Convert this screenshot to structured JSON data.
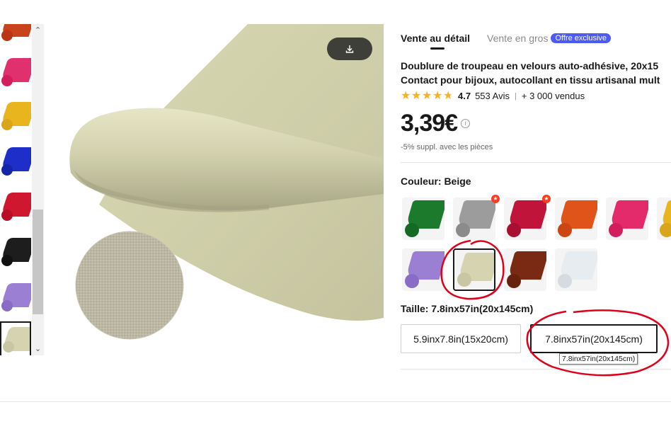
{
  "thumbnails": [
    {
      "name": "orange",
      "roll": "#c9431d",
      "dot": "#b83614"
    },
    {
      "name": "rose",
      "roll": "#e0306e",
      "dot": "#d41d5d"
    },
    {
      "name": "yellow",
      "roll": "#e8b51e",
      "dot": "#d9a51a"
    },
    {
      "name": "blue",
      "roll": "#1d2fc8",
      "dot": "#1625a8"
    },
    {
      "name": "red",
      "roll": "#cf1730",
      "dot": "#b80f26"
    },
    {
      "name": "black",
      "roll": "#1d1d1d",
      "dot": "#111111"
    },
    {
      "name": "lavender",
      "roll": "#9a7fd3",
      "dot": "#8a6cc6"
    },
    {
      "name": "beige",
      "roll": "#d6d3b0",
      "dot": "#c9c6a4"
    }
  ],
  "tabs": {
    "retail": "Vente au détail",
    "wholesale": "Vente en gros",
    "exclusive_badge": "Offre exclusive"
  },
  "product": {
    "title_line1": "Doublure de troupeau en velours auto-adhésive, 20x15",
    "title_line2": "Contact pour bijoux, autocollant en tissu artisanal mult",
    "rating": "4.7",
    "reviews": "553 Avis",
    "separator": "|",
    "sold": "+ 3 000 vendus",
    "stars": 4.7,
    "price": "3,39€",
    "discount_note": "-5% suppl. avec les pièces"
  },
  "color": {
    "label": "Couleur: Beige",
    "swatches": [
      {
        "name": "green",
        "roll": "#1c7a2c",
        "dot": "#156a23",
        "hot": false
      },
      {
        "name": "grey",
        "roll": "#9c9c9c",
        "dot": "#8b8b8b",
        "hot": true
      },
      {
        "name": "crimson",
        "roll": "#c0143a",
        "dot": "#a80f31",
        "hot": true
      },
      {
        "name": "orange",
        "roll": "#e0541a",
        "dot": "#cc4512",
        "hot": false
      },
      {
        "name": "pink",
        "roll": "#e32b6c",
        "dot": "#d41d5d",
        "hot": false
      },
      {
        "name": "yellow",
        "roll": "#e8b51e",
        "dot": "#d9a51a",
        "hot": false
      },
      {
        "name": "lavender",
        "roll": "#9a7fd3",
        "dot": "#8a6cc6",
        "hot": false
      },
      {
        "name": "beige",
        "roll": "#d6d3b0",
        "dot": "#c9c6a4",
        "hot": false,
        "selected": true
      },
      {
        "name": "brown",
        "roll": "#7a2a12",
        "dot": "#68210c",
        "hot": false
      },
      {
        "name": "white",
        "roll": "#e6ecf0",
        "dot": "#d5dbe0",
        "hot": false
      }
    ]
  },
  "size": {
    "label": "Taille: 7.8inx57in(20x145cm)",
    "options": [
      "5.9inx7.8in(15x20cm)",
      "7.8inx57in(20x145cm)"
    ],
    "tooltip": "7.8inx57in(20x145cm)"
  },
  "colors": {
    "accent": "#4d5bf4",
    "star": "#fbb11b",
    "annotation": "#e0001a"
  }
}
